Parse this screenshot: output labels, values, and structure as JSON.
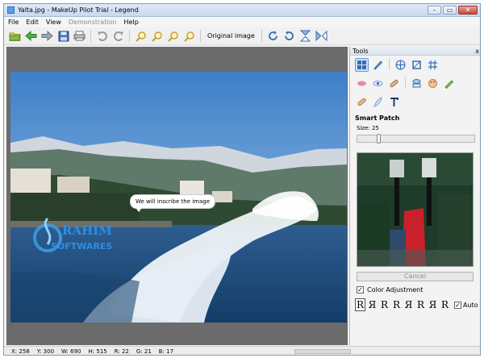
{
  "window": {
    "title": "Yalta.jpg - MakeUp Pilot Trial - Legend"
  },
  "window_controls": {
    "minimize": "–",
    "maximize": "▭",
    "close": "✕"
  },
  "menu": [
    "File",
    "Edit",
    "View",
    "Demonstration",
    "Help"
  ],
  "toolbar": {
    "original_image_label": "Original image"
  },
  "photo": {
    "callout_text": "We will inscribe the image",
    "watermark_top": "RAHIM",
    "watermark_bottom": "SOFTWARES"
  },
  "tools_panel": {
    "header": "Tools",
    "close_glyph": "x",
    "section_title": "Smart Patch",
    "size_label": "Size: 25",
    "size_value": 25,
    "cancel_label": "Cancel",
    "color_adjustment_label": "Color Adjustment",
    "color_adjustment_checked": true,
    "glyphs": [
      "R",
      "Я",
      "R",
      "R",
      "Я",
      "R",
      "Я",
      "R"
    ],
    "auto_label": "Auto",
    "auto_checked": true
  },
  "status": {
    "x": "X: 258",
    "y": "Y: 300",
    "w": "W: 690",
    "h": "H: 515",
    "r": "R: 22",
    "g": "G: 21",
    "b": "B: 17"
  },
  "colors": {
    "title_bg": "#c9d9ee",
    "canvas_bg": "#6b6b6b",
    "panel_bg": "#f3f3f3",
    "accent": "#2d6fb8"
  }
}
